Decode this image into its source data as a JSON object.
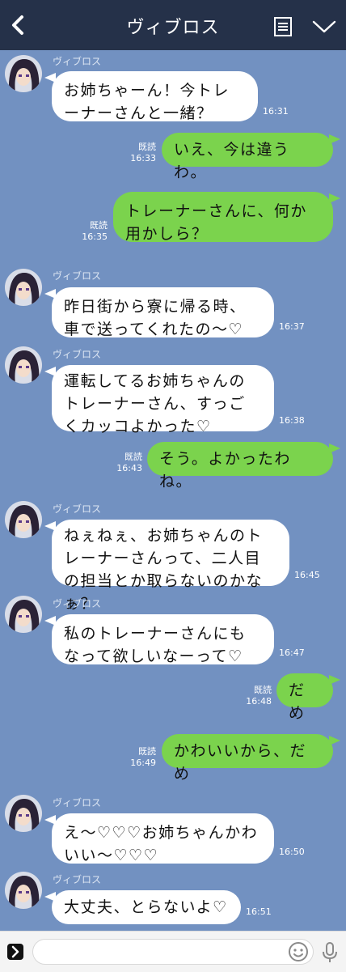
{
  "header": {
    "title": "ヴィブロス"
  },
  "messages": [
    {
      "sender": "ヴィブロス",
      "text": "お姉ちゃーん！今トレーナーさんと一緒？",
      "time": "16:31"
    },
    {
      "read": "既読",
      "text": "いえ、今は違うわ。",
      "time": "16:33"
    },
    {
      "read": "既読",
      "text": "トレーナーさんに、何か用かしら？",
      "time": "16:35"
    },
    {
      "sender": "ヴィブロス",
      "text": "昨日街から寮に帰る時、車で送ってくれたの〜♡",
      "time": "16:37"
    },
    {
      "sender": "ヴィブロス",
      "text": "運転してるお姉ちゃんのトレーナーさん、すっごくカッコよかった♡",
      "time": "16:38"
    },
    {
      "read": "既読",
      "text": "そう。よかったわね。",
      "time": "16:43"
    },
    {
      "sender": "ヴィブロス",
      "text": "ねぇねぇ、お姉ちゃんのトレーナーさんって、二人目の担当とか取らないのかなぁ？",
      "time": "16:45"
    },
    {
      "sender": "ヴィブロス",
      "text": "私のトレーナーさんにもなって欲しいなーって♡",
      "time": "16:47"
    },
    {
      "read": "既読",
      "text": "だめ",
      "time": "16:48"
    },
    {
      "read": "既読",
      "text": "かわいいから、だめ",
      "time": "16:49"
    },
    {
      "sender": "ヴィブロス",
      "text": "え〜♡♡♡お姉ちゃんかわいい〜♡♡♡",
      "time": "16:50"
    },
    {
      "sender": "ヴィブロス",
      "text": "大丈夫、とらないよ♡",
      "time": "16:51"
    }
  ],
  "icons": {
    "back": "chevron-left-icon",
    "notes": "notes-icon",
    "menu": "chevron-down-icon",
    "expand": "expand-icon",
    "emoji": "emoji-icon",
    "mic": "microphone-icon"
  },
  "colors": {
    "header_bg": "#253149",
    "chat_bg": "#7291c1",
    "incoming_bubble": "#ffffff",
    "outgoing_bubble": "#7bd34d",
    "footer_bg": "#f4f4f4"
  }
}
